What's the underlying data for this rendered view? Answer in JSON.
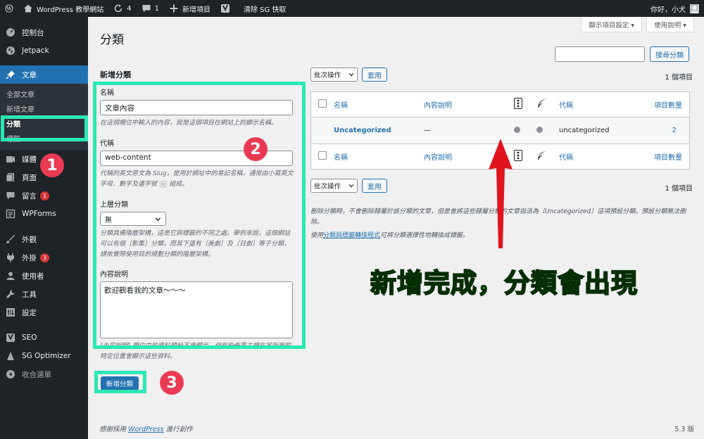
{
  "admin_bar": {
    "site_name": "WordPress 教學網站",
    "updates_count": "4",
    "comments_count": "1",
    "new_item": "新增項目",
    "sg_cache": "清除 SG 快取",
    "greeting": "你好，小犬"
  },
  "sidebar": {
    "dashboard": "控制台",
    "jetpack": "Jetpack",
    "posts": "文章",
    "sub_all_posts": "全部文章",
    "sub_new_post": "新增文章",
    "sub_categories": "分類",
    "sub_tags": "標籤",
    "media": "媒體",
    "pages": "頁面",
    "comments": "留言",
    "comments_badge": "1",
    "wpforms": "WPForms",
    "appearance": "外觀",
    "plugins": "外掛",
    "plugins_badge": "3",
    "users": "使用者",
    "tools": "工具",
    "settings": "設定",
    "seo": "SEO",
    "sg_optimizer": "SG Optimizer",
    "collapse": "收合選單"
  },
  "header": {
    "screen_options": "顯示項目設定 ▾",
    "help": "使用說明 ▾",
    "title": "分類"
  },
  "search": {
    "placeholder": "",
    "button": "搜尋分類"
  },
  "form": {
    "heading": "新增分類",
    "name_label": "名稱",
    "name_value": "文章內容",
    "name_desc": "在這個欄位中輸入的內容，就是這個項目在網站上的顯示名稱。",
    "slug_label": "代稱",
    "slug_value": "web-content",
    "slug_desc": "代稱的英文原文為 Slug，是用於網址中的易記名稱，通常由小寫英文字母、數字及連字號",
    "slug_dash": "-",
    "slug_desc_end": "組成。",
    "parent_label": "上層分類",
    "parent_value": "無",
    "parent_desc": "分類具備階層架構，這是它與標籤的不同之處。舉例來說，這個網站可以有個〔影集〕分類，而其下還有〔美劇〕及〔日劇〕等子分類，請依實際使用目的規劃分類的階層架構。",
    "description_label": "內容說明",
    "description_value": "歡迎觀看我的文章～～～",
    "description_desc": "[內容說明] 欄位中的資料預設不會顯示，但有些佈景主題在其版面的特定位置會顯示這些資料。",
    "submit": "新增分類"
  },
  "table": {
    "bulk_actions": "批次操作",
    "apply": "套用",
    "item_count": "1 個項目",
    "headers": {
      "name": "名稱",
      "description": "內容說明",
      "slug": "代稱",
      "count": "項目數量"
    },
    "rows": [
      {
        "name": "Uncategorized",
        "description": "—",
        "slug": "uncategorized",
        "count": "2"
      }
    ]
  },
  "notes": {
    "delete_note": "刪除分類時，不會刪除隸屬於該分類的文章，但是會將這些隸屬分類的文章指派為〔Uncategorized〕這項預設分類。預設分類無法刪除。",
    "convert_prefix": "使用",
    "convert_link": "分類與標籤轉換程式",
    "convert_suffix": "可將分類選擇性地轉換成標籤。"
  },
  "annotations": {
    "step1": "1",
    "step2": "2",
    "step3": "3",
    "caption": "新增完成，分類會出現",
    "highlight_color": "#2ce8b2",
    "circle_color": "#ea3a51",
    "arrow_color": "#e0141e",
    "caption_color": "#27f011"
  },
  "footer": {
    "thanks_prefix": "感謝採用",
    "thanks_link": "WordPress",
    "thanks_suffix": "進行創作",
    "version": "5.3 版"
  }
}
